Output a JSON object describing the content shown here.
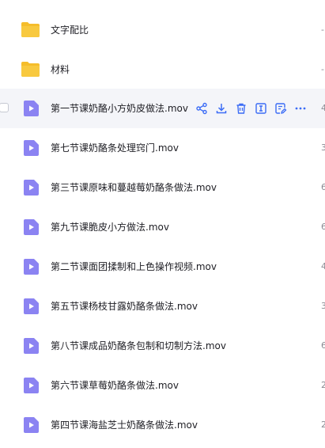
{
  "files": [
    {
      "type": "folder",
      "name": "文字配比",
      "size": "-"
    },
    {
      "type": "folder",
      "name": "材料",
      "size": "-"
    },
    {
      "type": "video",
      "name": "第一节课奶酪小方奶皮做法.mov",
      "size": "4",
      "selected": true
    },
    {
      "type": "video",
      "name": "第七节课奶酪条处理窍门.mov",
      "size": "3"
    },
    {
      "type": "video",
      "name": "第三节课原味和蔓越莓奶酪条做法.mov",
      "size": "6"
    },
    {
      "type": "video",
      "name": "第九节课脆皮小方做法.mov",
      "size": "6"
    },
    {
      "type": "video",
      "name": "第二节课面团揉制和上色操作视频.mov",
      "size": "4"
    },
    {
      "type": "video",
      "name": "第五节课杨枝甘露奶酪条做法.mov",
      "size": "3"
    },
    {
      "type": "video",
      "name": "第八节课成品奶酪条包制和切制方法.mov",
      "size": "6"
    },
    {
      "type": "video",
      "name": "第六节课草莓奶酪条做法.mov",
      "size": "2"
    },
    {
      "type": "video",
      "name": "第四节课海盐芝士奶酪条做法.mov",
      "size": "2"
    }
  ],
  "row_actions": [
    "share-icon",
    "download-icon",
    "delete-icon",
    "rename-icon",
    "edit-icon",
    "more-icon"
  ],
  "colors": {
    "accent": "#3b6cf6",
    "folder": "#f5bd2b",
    "video": "#8b83f2",
    "selected_bg": "#f4f5f9"
  }
}
